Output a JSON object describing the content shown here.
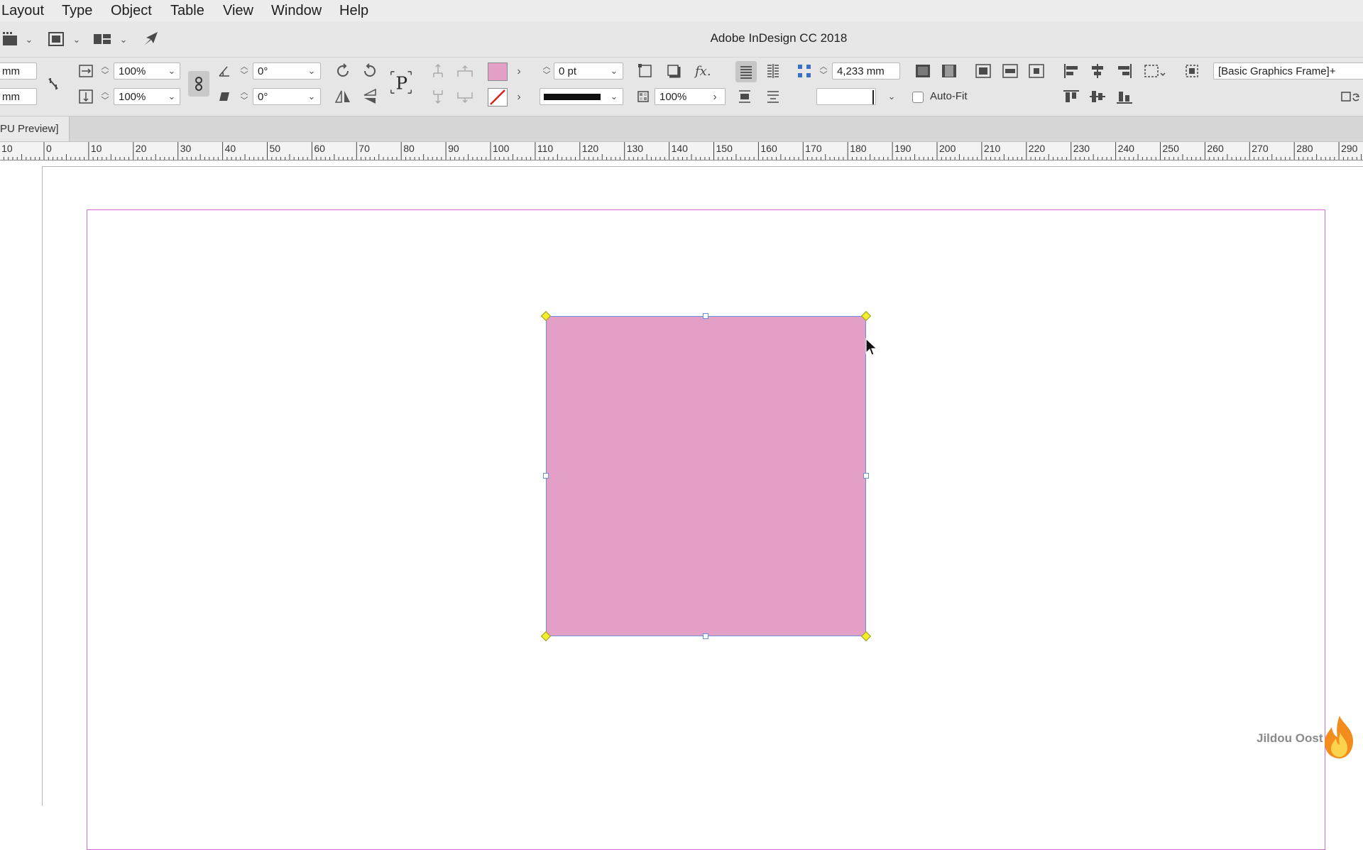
{
  "menu": {
    "items": [
      "Layout",
      "Type",
      "Object",
      "Table",
      "View",
      "Window",
      "Help"
    ]
  },
  "app_title": "Adobe InDesign CC 2018",
  "control_panel": {
    "x_unit": "mm",
    "y_unit": "mm",
    "scale_x": "100%",
    "scale_y": "100%",
    "rotate_angle": "0°",
    "shear_angle": "0°",
    "stroke_weight": "0 pt",
    "opacity": "100%",
    "gutter": "4,233 mm",
    "auto_fit_label": "Auto-Fit",
    "auto_fit_checked": false,
    "object_style": "[Basic Graphics Frame]+",
    "fill_color": "#e39fc6",
    "stroke_color": "none"
  },
  "document_tab": {
    "label": "PU Preview]"
  },
  "ruler": {
    "labels": [
      "10",
      "0",
      "10",
      "20",
      "30",
      "40",
      "50",
      "60",
      "70",
      "80",
      "90",
      "100",
      "110",
      "120",
      "130",
      "140",
      "150",
      "160",
      "170",
      "180",
      "190",
      "200",
      "210",
      "220",
      "230",
      "240",
      "250",
      "260",
      "270",
      "280",
      "290"
    ]
  },
  "canvas": {
    "frame_fill": "#e39fc6",
    "margin_guide_color": "#d46bd4",
    "selection_color": "#6d8fd8"
  },
  "watermark": {
    "text": "Jildou Oost"
  },
  "icons": [
    "frame-grid-icon",
    "fitting-icon",
    "view-options-icon",
    "publish-icon",
    "scale-x-icon",
    "scale-y-icon",
    "link-icon",
    "constrain-proportions-icon",
    "rotate-angle-icon",
    "shear-icon",
    "rotate-cw-icon",
    "rotate-ccw-icon",
    "text-frame-icon",
    "flip-horizontal-icon",
    "flip-vertical-icon",
    "select-container-icon",
    "select-content-icon",
    "fill-swatch-icon",
    "stroke-swatch-icon",
    "corner-options-icon",
    "drop-shadow-icon",
    "effects-icon",
    "opacity-icon",
    "align-text-icon",
    "columns-icon",
    "auto-fit-icon",
    "align-left-icon",
    "align-center-icon",
    "align-right-icon",
    "distribute-icon",
    "align-top-icon",
    "align-middle-icon",
    "align-bottom-icon",
    "object-style-icon",
    "flame-logo"
  ]
}
